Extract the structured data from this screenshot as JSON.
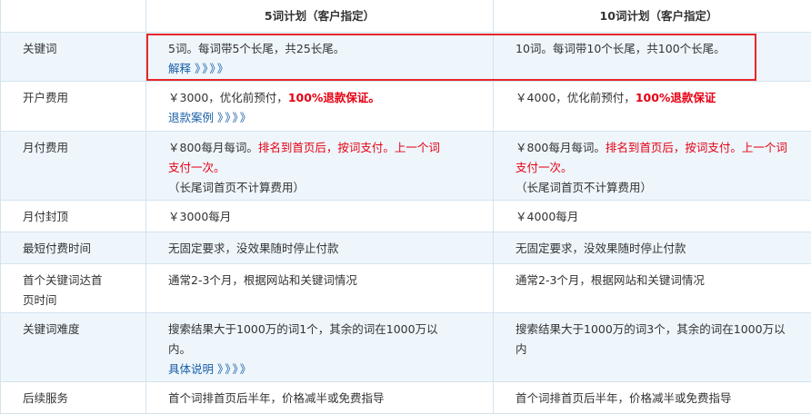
{
  "header": {
    "col0": "",
    "col1": "5词计划（客户指定）",
    "col2": "10词计划（客户指定）"
  },
  "rows": [
    {
      "label": "关键词",
      "plan5": {
        "l1": "5词。每词带5个长尾，共25长尾。",
        "link": "解释",
        "arrows": "》》》》"
      },
      "plan10": {
        "l1": "10词。每词带10个长尾，共100个长尾。"
      }
    },
    {
      "label": "开户费用",
      "plan5": {
        "prefix": "￥3000，优化前预付，",
        "emph": "100%退款保证。",
        "link": "退款案例",
        "arrows": "》》》》"
      },
      "plan10": {
        "prefix": "￥4000，优化前预付，",
        "emph": "100%退款保证"
      }
    },
    {
      "label": "月付费用",
      "plan5": {
        "prefix": "￥800每月每词。",
        "red1": "排名到首页后，按词支付。上一个词",
        "red2": "支付一次。",
        "note": "（长尾词首页不计算费用）"
      },
      "plan10": {
        "prefix": "￥800每月每词。",
        "red1": "排名到首页后，按词支付。上一个词",
        "red2": "支付一次。",
        "note": "（长尾词首页不计算费用）"
      }
    },
    {
      "label": "月付封顶",
      "plan5": {
        "l1": "￥3000每月"
      },
      "plan10": {
        "l1": "￥4000每月"
      }
    },
    {
      "label": "最短付费时间",
      "plan5": {
        "l1": "无固定要求，没效果随时停止付款"
      },
      "plan10": {
        "l1": "无固定要求，没效果随时停止付款"
      }
    },
    {
      "label1": "首个关键词达首",
      "label2": "页时间",
      "plan5": {
        "l1": "通常2-3个月，根据网站和关键词情况"
      },
      "plan10": {
        "l1": "通常2-3个月，根据网站和关键词情况"
      }
    },
    {
      "label": "关键词难度",
      "plan5": {
        "l1": "搜索结果大于1000万的词1个，其余的词在1000万以",
        "l2": "内。",
        "link": "具体说明",
        "arrows": "》》》》"
      },
      "plan10": {
        "l1": "搜索结果大于1000万的词3个，其余的词在1000万以",
        "l2": "内"
      }
    },
    {
      "label": "后续服务",
      "plan5": {
        "l1": "首个词排首页后半年，价格减半或免费指导"
      },
      "plan10": {
        "l1": "首个词排首页后半年，价格减半或免费指导"
      }
    }
  ],
  "colors": {
    "border": "#d4e3ee",
    "alt_bg": "#eef6fc",
    "emphasis": "#e60012",
    "link": "#1a5fa8",
    "highlight_box": "#e8262a"
  }
}
